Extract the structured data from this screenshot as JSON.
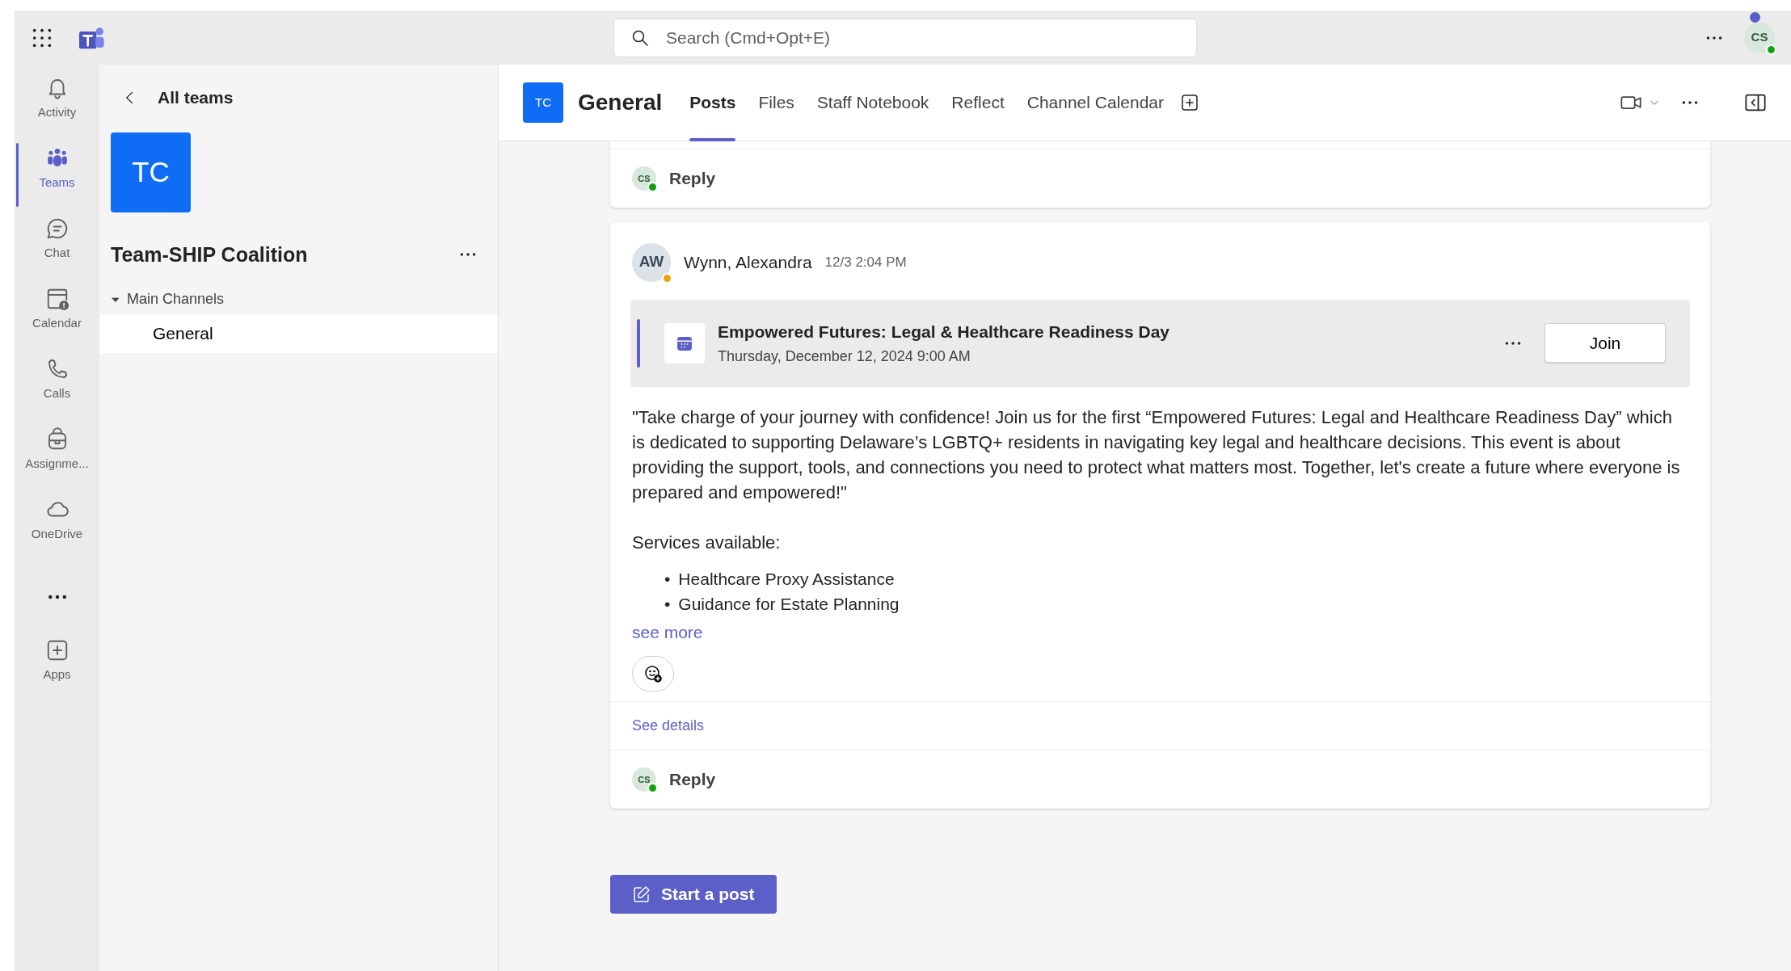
{
  "top_bar": {
    "search": {
      "placeholder": "Search (Cmd+Opt+E)"
    },
    "avatar": {
      "initials": "CS",
      "status_dot": {
        "color": "#13a10e"
      }
    },
    "notification": true
  },
  "app_rail": [
    {
      "label": "Activity",
      "selected": false
    },
    {
      "label": "Teams",
      "selected": true
    },
    {
      "label": "Chat",
      "selected": false
    },
    {
      "label": "Calendar",
      "selected": false
    },
    {
      "label": "Calls",
      "selected": false
    },
    {
      "label": "Assignme...",
      "selected": false
    },
    {
      "label": "OneDrive",
      "selected": false
    },
    {
      "label": "Apps",
      "selected": false
    }
  ],
  "team_panel": {
    "back": "All teams",
    "team_initials": "TC",
    "team_name": "Team-SHIP Coalition",
    "sections": [
      {
        "label": "Main Channels",
        "expanded": true,
        "children": [
          {
            "label": "General",
            "selected": true
          }
        ]
      }
    ]
  },
  "channel_header": {
    "team_initials": "TC",
    "title": "General",
    "tabs": [
      {
        "label": "Posts",
        "selected": true
      },
      {
        "label": "Files",
        "selected": false
      },
      {
        "label": "Staff Notebook",
        "selected": false
      },
      {
        "label": "Reflect",
        "selected": false
      },
      {
        "label": "Channel Calendar",
        "selected": false
      }
    ]
  },
  "posts": [
    {
      "kind": "reply_only",
      "reply": {
        "label": "Reply",
        "initials": "CS",
        "status_dot": {
          "color": "#13a10e"
        }
      }
    },
    {
      "kind": "message",
      "author": "Wynn, Alexandra",
      "initials": "AW",
      "status_dot": {
        "color": "#eaa300"
      },
      "time": "12/3 2:04 PM",
      "meeting": {
        "title": "Empowered Futures: Legal & Healthcare Readiness Day",
        "date": "Thursday, December 12, 2024 9:00 AM",
        "button": "Join"
      },
      "paragraphs": [
        "\"Take charge of your journey with confidence! Join us for the first “Empowered Futures: Legal and Healthcare Readiness Day” which is dedicated to supporting Delaware’s LGBTQ+ residents in navigating key legal and healthcare decisions. This event is about providing the support, tools, and connections you need to protect what matters most. Together, let's create a future where everyone is prepared and empowered!\"",
        "Services available:"
      ],
      "bullets": [
        {
          "marker": "•",
          "text": "Healthcare Proxy Assistance"
        },
        {
          "marker": "•",
          "text": "Guidance for Estate Planning"
        }
      ],
      "see_more": "see more",
      "see_details": "See details",
      "reply": {
        "label": "Reply",
        "initials": "CS",
        "status_dot": {
          "color": "#13a10e"
        }
      }
    }
  ],
  "start_post": "Start a post"
}
